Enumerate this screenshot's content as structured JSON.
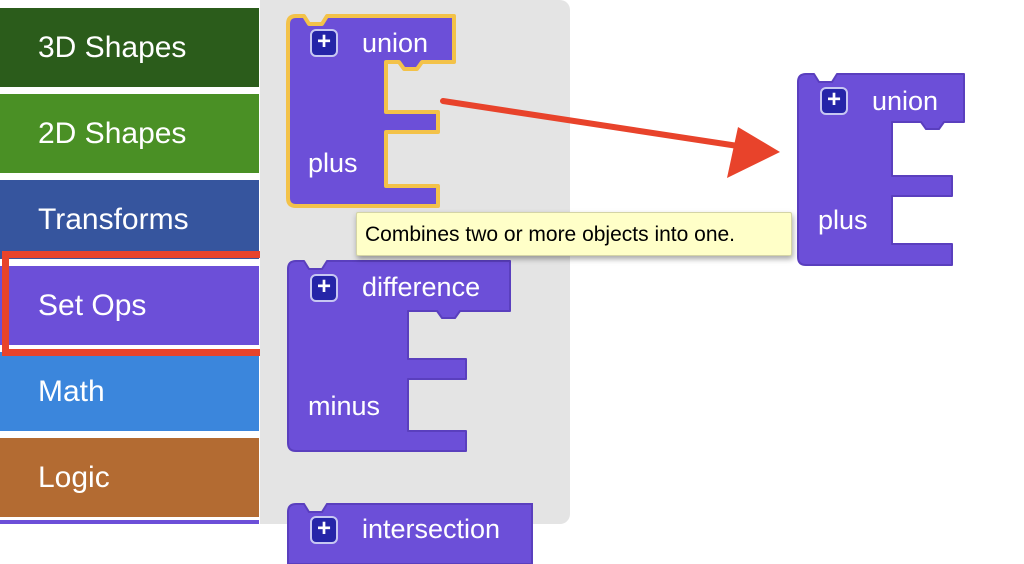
{
  "categories": [
    {
      "label": "3D Shapes",
      "color": "#2b5c1b"
    },
    {
      "label": "2D Shapes",
      "color": "#4a9025"
    },
    {
      "label": "Transforms",
      "color": "#36559e"
    },
    {
      "label": "Set Ops",
      "color": "#6c4fd8",
      "selected": true
    },
    {
      "label": "Math",
      "color": "#3b86dc"
    },
    {
      "label": "Logic",
      "color": "#b36b32"
    }
  ],
  "flyout": {
    "blocks": [
      {
        "title": "union",
        "input_label": "plus",
        "mutator_icon": "plus-icon",
        "highlighted": true
      },
      {
        "title": "difference",
        "input_label": "minus",
        "mutator_icon": "plus-icon"
      },
      {
        "title": "intersection",
        "mutator_icon": "plus-icon"
      }
    ]
  },
  "tooltip": {
    "text": "Combines two or more objects into one."
  },
  "workspace_block": {
    "title": "union",
    "input_label": "plus",
    "mutator_icon": "plus-icon"
  },
  "colors": {
    "block": "#6c4fd8",
    "block_border": "#5a3fbe",
    "highlight": "#f3c249",
    "annotation": "#e8432b",
    "flyout_bg": "#e4e4e4"
  }
}
